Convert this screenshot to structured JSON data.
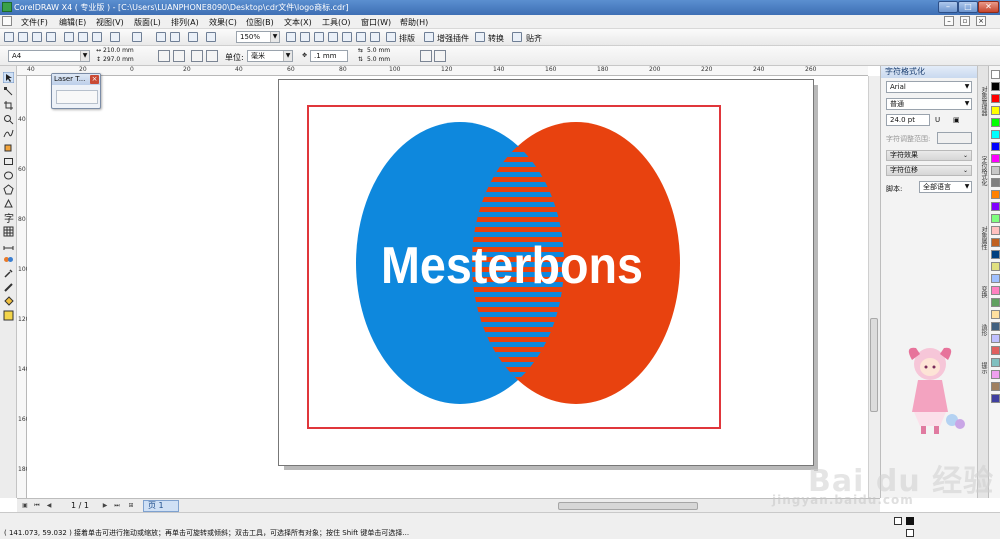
{
  "window": {
    "title": "CorelDRAW X4 ( 专业版 ) - [C:\\Users\\LUANPHONE8090\\Desktop\\cdr文件\\logo商标.cdr]"
  },
  "menu": {
    "items": [
      "文件(F)",
      "编辑(E)",
      "视图(V)",
      "版面(L)",
      "排列(A)",
      "效果(C)",
      "位图(B)",
      "文本(X)",
      "工具(O)",
      "窗口(W)",
      "帮助(H)"
    ]
  },
  "toolbar": {
    "zoom": "150%",
    "paiban": "排版",
    "plugin": "增强插件",
    "convert": "转换",
    "paste": "贴齐"
  },
  "property_bar": {
    "paper": "A4",
    "width": "210.0 mm",
    "height": "297.0 mm",
    "unit_label": "单位:",
    "unit": "毫米",
    "nudge": ".1 mm",
    "dup_x": "5.0 mm",
    "dup_y": "5.0 mm"
  },
  "rulers": {
    "h_ticks": [
      "40",
      "20",
      "0",
      "20",
      "40",
      "60",
      "80",
      "100",
      "120",
      "140",
      "160",
      "180",
      "200",
      "220",
      "240",
      "260"
    ],
    "v_ticks": [
      "40",
      "60",
      "80",
      "100",
      "120",
      "140",
      "160",
      "180",
      "200"
    ]
  },
  "laser_docker": {
    "title": "Laser T..."
  },
  "logo": {
    "text": "Mesterbons",
    "left_color": "#0e88dd",
    "right_color": "#e8420f",
    "frame_color": "#e0363b"
  },
  "pager": {
    "count": "1 / 1",
    "tab": "页 1"
  },
  "status": {
    "text": "( 141.073, 59.032 ) 接着单击可进行拖动或缩放；再单击可旋转或倾斜；双击工具，可选择所有对象；按住 Shift 键单击可选择..."
  },
  "docker": {
    "title": "字符格式化",
    "font": "Arial",
    "style": "普通",
    "size": "24.0 pt",
    "kerning_label": "字符调整范围:",
    "effects": "字符效果",
    "shift": "字符位移",
    "script_label": "脚本:",
    "script": "全部语言"
  },
  "side_tabs": [
    "对象管理器",
    "字符格式化",
    "对象属性",
    "变换",
    "造形",
    "提示"
  ],
  "palette": [
    "#ffffff",
    "#000000",
    "#ff0000",
    "#ffff00",
    "#00ff00",
    "#00ffff",
    "#0000ff",
    "#ff00ff",
    "#c8c8c8",
    "#808080",
    "#ff8000",
    "#8000ff",
    "#80ff80",
    "#ffc0c0",
    "#c06020",
    "#004080",
    "#e0e080",
    "#a0c0ff",
    "#ff80c0",
    "#60a060",
    "#ffe0a0",
    "#406080",
    "#c0c0ff",
    "#e06060",
    "#80c0c0",
    "#f0a0f0",
    "#a08060",
    "#4040a0"
  ],
  "watermark": {
    "text": "Bai du 经验",
    "url": "jingyan.baidu.com"
  }
}
